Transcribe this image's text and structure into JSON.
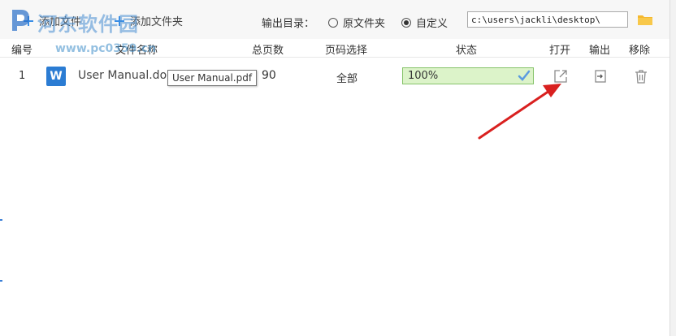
{
  "toolbar": {
    "add_file_label": "添加文件",
    "add_folder_label": "添加文件夹",
    "output_dir_label": "输出目录：",
    "radio_source_label": "原文件夹",
    "radio_custom_label": "自定义",
    "radio_selected": "custom",
    "output_path": "c:\\users\\jackli\\desktop\\"
  },
  "table": {
    "headers": {
      "num": "编号",
      "name": "文件名称",
      "pages": "总页数",
      "range": "页码选择",
      "status": "状态",
      "open": "打开",
      "export": "输出",
      "remove": "移除"
    },
    "rows": [
      {
        "num": "1",
        "file_type_icon": "W",
        "name": "User Manual.doc",
        "pages": "90",
        "range": "全部",
        "status_text": "100%",
        "progress_percent": 100
      }
    ]
  },
  "tooltip": "User Manual.pdf",
  "watermark": {
    "text": "河东软件园",
    "url": "www.pc0359.cn"
  },
  "icons": {
    "add": "plus-icon",
    "folder": "folder-icon",
    "open": "external-link-icon",
    "export": "export-icon",
    "delete": "trash-icon",
    "done": "check-icon"
  },
  "colors": {
    "accent": "#3a8ee6",
    "progress_border": "#86c36a",
    "progress_fill": "#dcf3c9",
    "arrow": "#d9201f",
    "word_icon": "#2b7cd3"
  }
}
